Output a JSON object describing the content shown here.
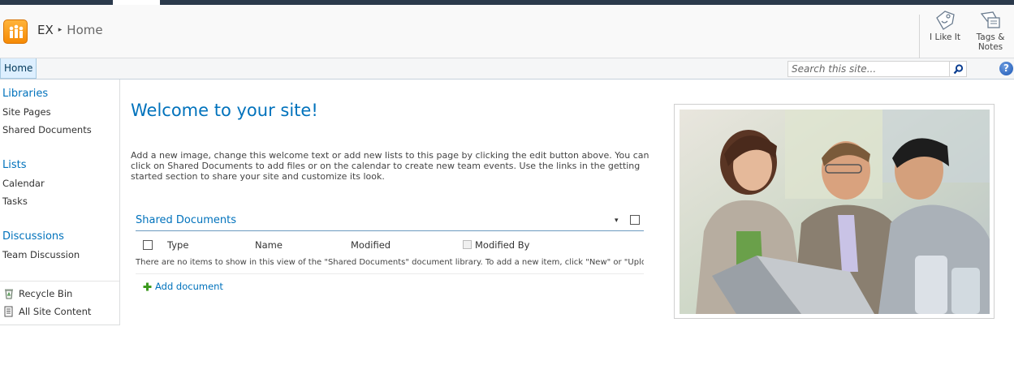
{
  "header": {
    "site_name": "EX",
    "separator": "▸",
    "page_name": "Home",
    "like_label": "I Like It",
    "tags_label_line1": "Tags &",
    "tags_label_line2": "Notes"
  },
  "topnav": {
    "home_tab": "Home",
    "search_placeholder": "Search this site...",
    "help_label": "?"
  },
  "quicklaunch": {
    "libraries_heading": "Libraries",
    "libraries": [
      "Site Pages",
      "Shared Documents"
    ],
    "lists_heading": "Lists",
    "lists": [
      "Calendar",
      "Tasks"
    ],
    "discussions_heading": "Discussions",
    "discussions": [
      "Team Discussion"
    ],
    "recycle_bin": "Recycle Bin",
    "all_site_content": "All Site Content"
  },
  "main": {
    "welcome_title": "Welcome to your site!",
    "welcome_text": "Add a new image, change this welcome text or add new lists to this page by clicking the edit button above. You can click on Shared Documents to add files or on the calendar to create new team events. Use the links in the getting started section to share your site and customize its look.",
    "webpart": {
      "title": "Shared Documents",
      "menu_arrow": "▾",
      "columns": [
        "Type",
        "Name",
        "Modified",
        "Modified By"
      ],
      "empty_message": "There are no items to show in this view of the \"Shared Documents\" document library. To add a new item, click \"New\" or \"Upload\".",
      "add_document": "Add document"
    }
  },
  "colors": {
    "accent_blue": "#0072bc",
    "ribbon_dark": "#2b3a4c",
    "logo_orange": "#f58a05"
  }
}
